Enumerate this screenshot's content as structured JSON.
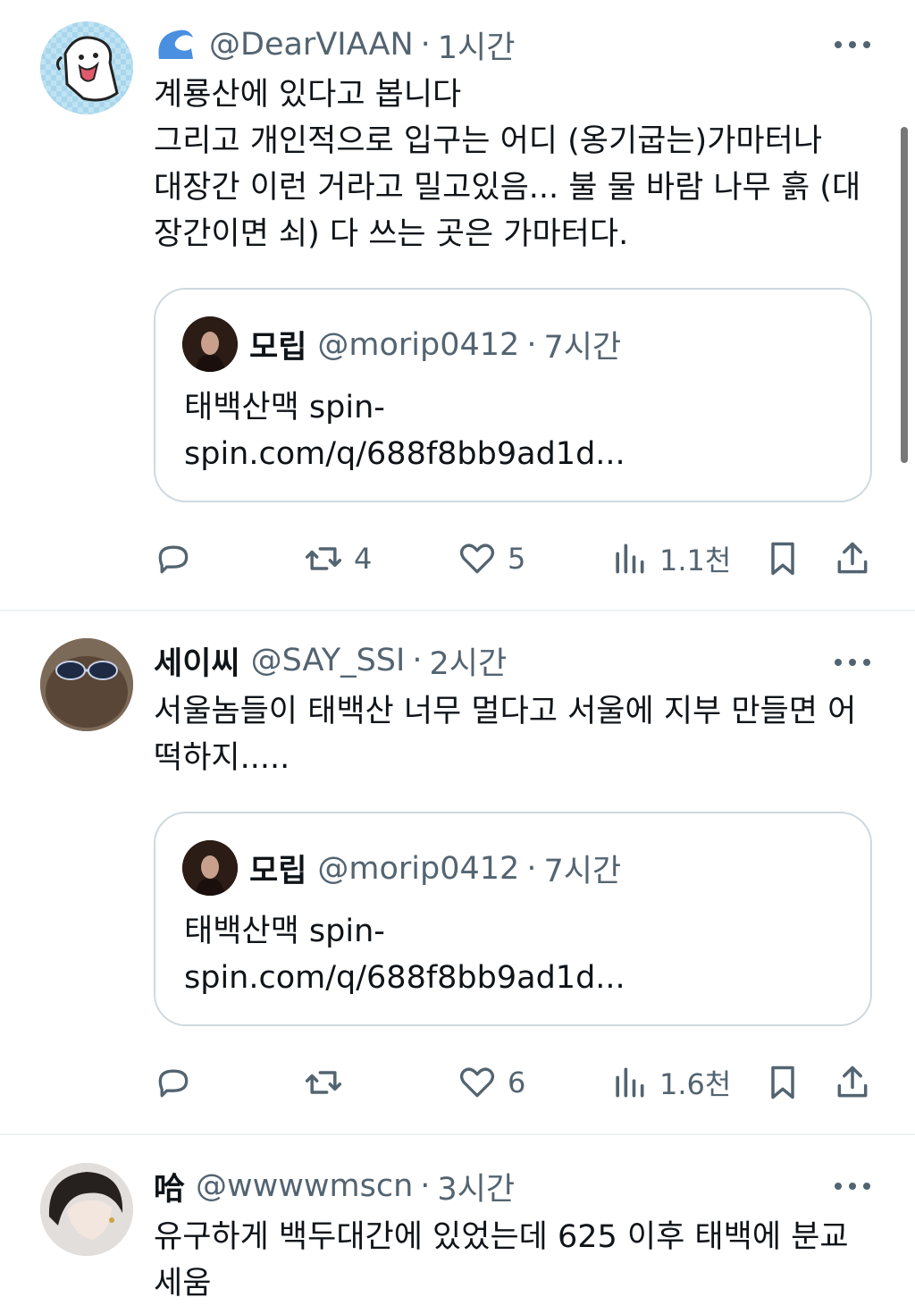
{
  "posts": [
    {
      "name": "",
      "handle": "@DearVIAAN",
      "time": "1시간",
      "body": "계룡산에 있다고 봅니다\n그리고 개인적으로 입구는 어디 (옹기굽는)가마터나\n대장간 이런 거라고 밀고있음... 불 물 바람 나무 흙 (대\n장간이면 쇠) 다 쓰는 곳은 가마터다.",
      "quote": {
        "name": "모립",
        "handle": "@morip0412",
        "time": "7시간",
        "body": "태백산맥  spin-\nspin.com/q/688f8bb9ad1d..."
      },
      "stats": {
        "replies": "",
        "reposts": "4",
        "likes": "5",
        "views": "1.1천"
      }
    },
    {
      "name": "세이씨",
      "handle": "@SAY_SSI",
      "time": "2시간",
      "body": "서울놈들이 태백산 너무 멀다고 서울에 지부 만들면 어\n떡하지.....",
      "quote": {
        "name": "모립",
        "handle": "@morip0412",
        "time": "7시간",
        "body": "태백산맥  spin-\nspin.com/q/688f8bb9ad1d..."
      },
      "stats": {
        "replies": "",
        "reposts": "",
        "likes": "6",
        "views": "1.6천"
      }
    },
    {
      "name": "哈",
      "handle": "@wwwwmscn",
      "time": "3시간",
      "body": "유구하게 백두대간에 있었는데 625 이후 태백에 분교\n세움"
    }
  ],
  "colors": {
    "text": "#0f1419",
    "secondary": "#536471",
    "border": "#cfd9de",
    "divider": "#eff3f4",
    "verified_blue": "#4a8fe0"
  },
  "icons": [
    "verified-wave-icon",
    "more-icon",
    "reply-icon",
    "repost-icon",
    "like-icon",
    "views-icon",
    "bookmark-icon",
    "share-icon"
  ]
}
